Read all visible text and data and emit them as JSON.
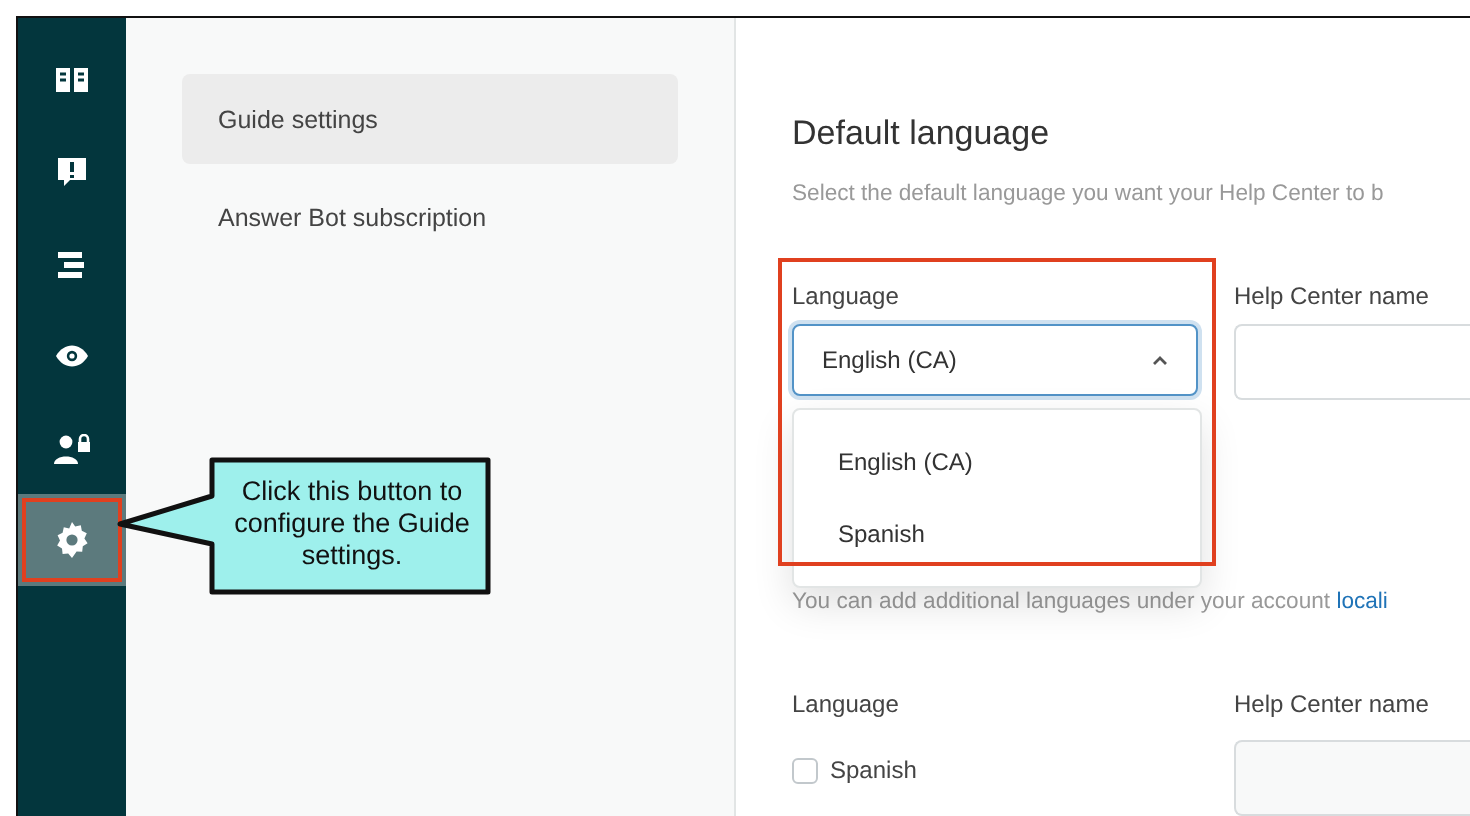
{
  "sidebar": {
    "items": [
      {
        "kind": "book",
        "selected": false,
        "highlighted": false
      },
      {
        "kind": "alert",
        "selected": false,
        "highlighted": false
      },
      {
        "kind": "lines",
        "selected": false,
        "highlighted": false
      },
      {
        "kind": "eye",
        "selected": false,
        "highlighted": false
      },
      {
        "kind": "user-lock",
        "selected": false,
        "highlighted": false
      },
      {
        "kind": "gear",
        "selected": true,
        "highlighted": true
      }
    ]
  },
  "callout": {
    "text": "Click this button to configure the Guide settings."
  },
  "nav": {
    "items": [
      {
        "label": "Guide settings",
        "selected": true
      },
      {
        "label": "Answer Bot subscription",
        "selected": false
      }
    ]
  },
  "main": {
    "title": "Default language",
    "description": "Select the default language you want your Help Center to b",
    "default_row": {
      "language_label": "Language",
      "select_value": "English (CA)",
      "expanded": true,
      "highlighted": true,
      "options": [
        "English (CA)",
        "Spanish"
      ],
      "name_label": "Help Center name"
    },
    "note": {
      "text": "You can add additional languages under your account ",
      "link": "locali"
    },
    "additional": {
      "language_label": "Language",
      "name_label": "Help Center name",
      "languages": [
        {
          "label": "Spanish",
          "checked": false
        }
      ]
    }
  }
}
